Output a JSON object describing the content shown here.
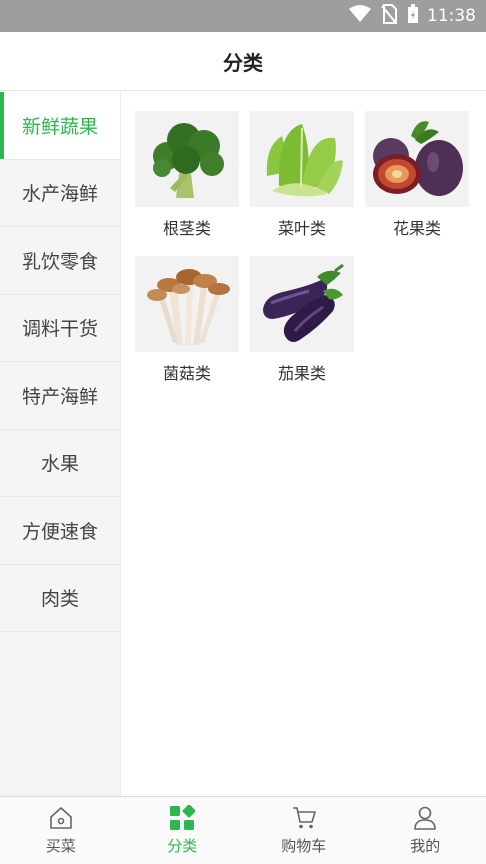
{
  "status_bar": {
    "time": "11:38",
    "icons": [
      "wifi-icon",
      "no-sim-icon",
      "battery-icon"
    ]
  },
  "header": {
    "title": "分类"
  },
  "sidebar": {
    "items": [
      {
        "label": "新鲜蔬果",
        "active": true
      },
      {
        "label": "水产海鲜"
      },
      {
        "label": "乳饮零食"
      },
      {
        "label": "调料干货"
      },
      {
        "label": "特产海鲜"
      },
      {
        "label": "水果"
      },
      {
        "label": "方便速食"
      },
      {
        "label": "肉类"
      }
    ]
  },
  "categories": [
    {
      "label": "根茎类",
      "image": "broccoli"
    },
    {
      "label": "菜叶类",
      "image": "lettuce"
    },
    {
      "label": "花果类",
      "image": "figs"
    },
    {
      "label": "菌菇类",
      "image": "mushrooms"
    },
    {
      "label": "茄果类",
      "image": "eggplants"
    }
  ],
  "tabbar": {
    "tabs": [
      {
        "label": "买菜",
        "icon": "home-icon"
      },
      {
        "label": "分类",
        "icon": "category-grid-icon",
        "active": true
      },
      {
        "label": "购物车",
        "icon": "cart-icon"
      },
      {
        "label": "我的",
        "icon": "user-icon"
      }
    ]
  },
  "colors": {
    "accent": "#2db74e",
    "status_bar": "#9e9e9e",
    "sidebar_bg": "#f5f5f5"
  }
}
